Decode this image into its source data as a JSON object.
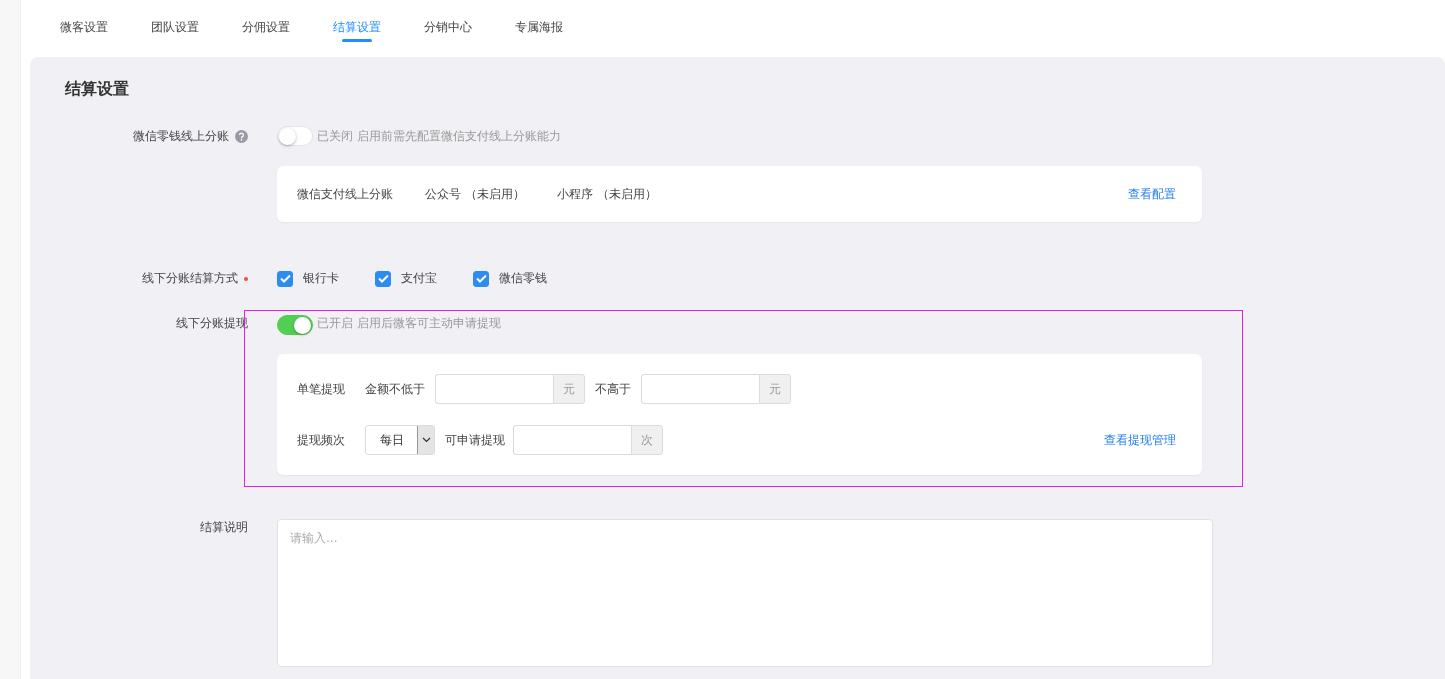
{
  "tabs": [
    {
      "label": "微客设置",
      "selected": false
    },
    {
      "label": "团队设置",
      "selected": false
    },
    {
      "label": "分佣设置",
      "selected": false
    },
    {
      "label": "结算设置",
      "selected": true
    },
    {
      "label": "分销中心",
      "selected": false
    },
    {
      "label": "专属海报",
      "selected": false
    }
  ],
  "panel": {
    "title": "结算设置"
  },
  "online_split": {
    "label": "微信零钱线上分账",
    "toggle": {
      "on": false,
      "status": "已关闭",
      "hint": "启用前需先配置微信支付线上分账能力"
    },
    "card": {
      "title": "微信支付线上分账",
      "items": [
        "公众号 （未启用）",
        "小程序 （未启用）"
      ],
      "link": "查看配置"
    }
  },
  "offline_methods": {
    "label": "线下分账结算方式",
    "required": true,
    "options": [
      {
        "label": "银行卡",
        "checked": true
      },
      {
        "label": "支付宝",
        "checked": true
      },
      {
        "label": "微信零钱",
        "checked": true
      }
    ]
  },
  "offline_withdraw": {
    "label": "线下分账提现",
    "toggle": {
      "on": true,
      "status": "已开启",
      "hint": "启用后微客可主动申请提现"
    },
    "card": {
      "single_label": "单笔提现",
      "min_label": "金额不低于",
      "min_unit": "元",
      "max_label": "不高于",
      "max_unit": "元",
      "frequency_label": "提现频次",
      "frequency_value": "每日",
      "count_label": "可申请提现",
      "count_unit": "次",
      "link": "查看提现管理"
    }
  },
  "note": {
    "label": "结算说明",
    "placeholder": "请输入..."
  }
}
